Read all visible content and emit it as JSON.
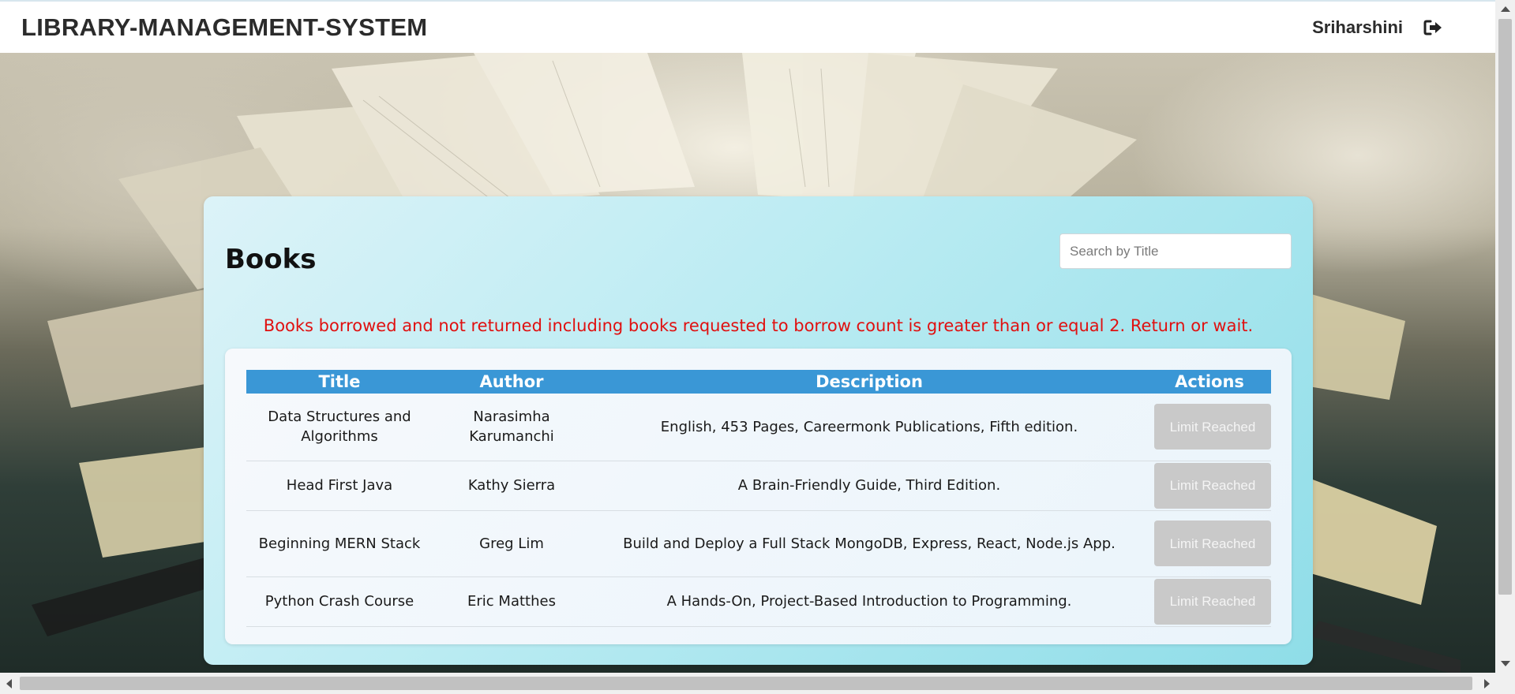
{
  "header": {
    "brand": "LIBRARY-MANAGEMENT-SYSTEM",
    "username": "Sriharshini",
    "logout_icon": "logout-icon"
  },
  "books": {
    "title": "Books",
    "search_placeholder": "Search by Title",
    "search_value": "",
    "warning": "Books borrowed and not returned including books requested to borrow count is greater than or equal 2. Return or wait.",
    "columns": [
      "Title",
      "Author",
      "Description",
      "Actions"
    ],
    "rows": [
      {
        "title": "Data Structures and Algorithms",
        "author": "Narasimha Karumanchi",
        "description": "English, 453 Pages, Careermonk Publications, Fifth edition.",
        "action": "Limit Reached"
      },
      {
        "title": "Head First Java",
        "author": "Kathy Sierra",
        "description": "A Brain-Friendly Guide, Third Edition.",
        "action": "Limit Reached"
      },
      {
        "title": "Beginning MERN Stack",
        "author": "Greg Lim",
        "description": "Build and Deploy a Full Stack MongoDB, Express, React, Node.js App.",
        "action": "Limit Reached"
      },
      {
        "title": "Python Crash Course",
        "author": "Eric Matthes",
        "description": "A Hands-On, Project-Based Introduction to Programming.",
        "action": "Limit Reached"
      }
    ]
  },
  "colors": {
    "warning_text": "#e01010",
    "table_header_bg": "#3a97d6",
    "disabled_button_bg": "#c9c9c9",
    "panel_gradient_end": "#8fdde8"
  }
}
